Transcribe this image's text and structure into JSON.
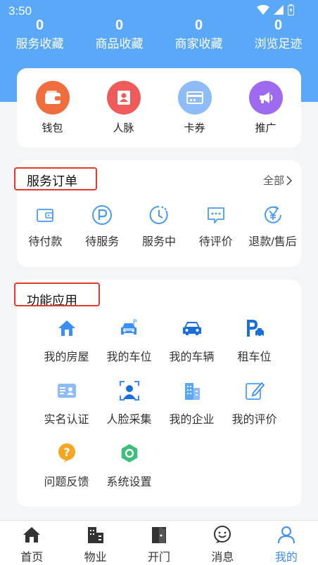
{
  "status_bar": {
    "time": "3:50"
  },
  "stats": [
    {
      "value": "0",
      "label": "服务收藏"
    },
    {
      "value": "0",
      "label": "商品收藏"
    },
    {
      "value": "0",
      "label": "商家收藏"
    },
    {
      "value": "0",
      "label": "浏览足迹"
    }
  ],
  "quick": [
    {
      "label": "钱包",
      "icon": "wallet-icon",
      "color": "#f26d3d"
    },
    {
      "label": "人脉",
      "icon": "contacts-icon",
      "color": "#ef5a5a"
    },
    {
      "label": "卡券",
      "icon": "card-icon",
      "color": "#8dbcf8"
    },
    {
      "label": "推广",
      "icon": "megaphone-icon",
      "color": "#9e6af0"
    }
  ],
  "orders": {
    "title": "服务订单",
    "all_label": "全部",
    "items": [
      {
        "label": "待付款",
        "icon": "wallet-outline-icon"
      },
      {
        "label": "待服务",
        "icon": "parking-circle-icon"
      },
      {
        "label": "服务中",
        "icon": "clock-icon"
      },
      {
        "label": "待评价",
        "icon": "comment-icon"
      },
      {
        "label": "退款/售后",
        "icon": "yen-refund-icon"
      }
    ]
  },
  "functions": {
    "title": "功能应用",
    "rows": [
      [
        {
          "label": "我的房屋",
          "icon": "house-icon"
        },
        {
          "label": "我的车位",
          "icon": "parking-car-icon"
        },
        {
          "label": "我的车辆",
          "icon": "car-icon"
        },
        {
          "label": "租车位",
          "icon": "rent-parking-icon"
        }
      ],
      [
        {
          "label": "实名认证",
          "icon": "id-card-icon"
        },
        {
          "label": "人脸采集",
          "icon": "face-scan-icon"
        },
        {
          "label": "我的企业",
          "icon": "building-icon"
        },
        {
          "label": "我的评价",
          "icon": "edit-icon"
        }
      ],
      [
        {
          "label": "问题反馈",
          "icon": "question-icon"
        },
        {
          "label": "系统设置",
          "icon": "settings-hex-icon"
        }
      ]
    ]
  },
  "tabs": [
    {
      "label": "首页",
      "icon": "home-icon"
    },
    {
      "label": "物业",
      "icon": "property-icon"
    },
    {
      "label": "开门",
      "icon": "door-icon"
    },
    {
      "label": "消息",
      "icon": "message-icon"
    },
    {
      "label": "我的",
      "icon": "profile-icon",
      "active": true
    }
  ],
  "colors": {
    "header": "#5aa9f8",
    "accent": "#3a8ef6",
    "highlight_box": "#e23b2e"
  }
}
